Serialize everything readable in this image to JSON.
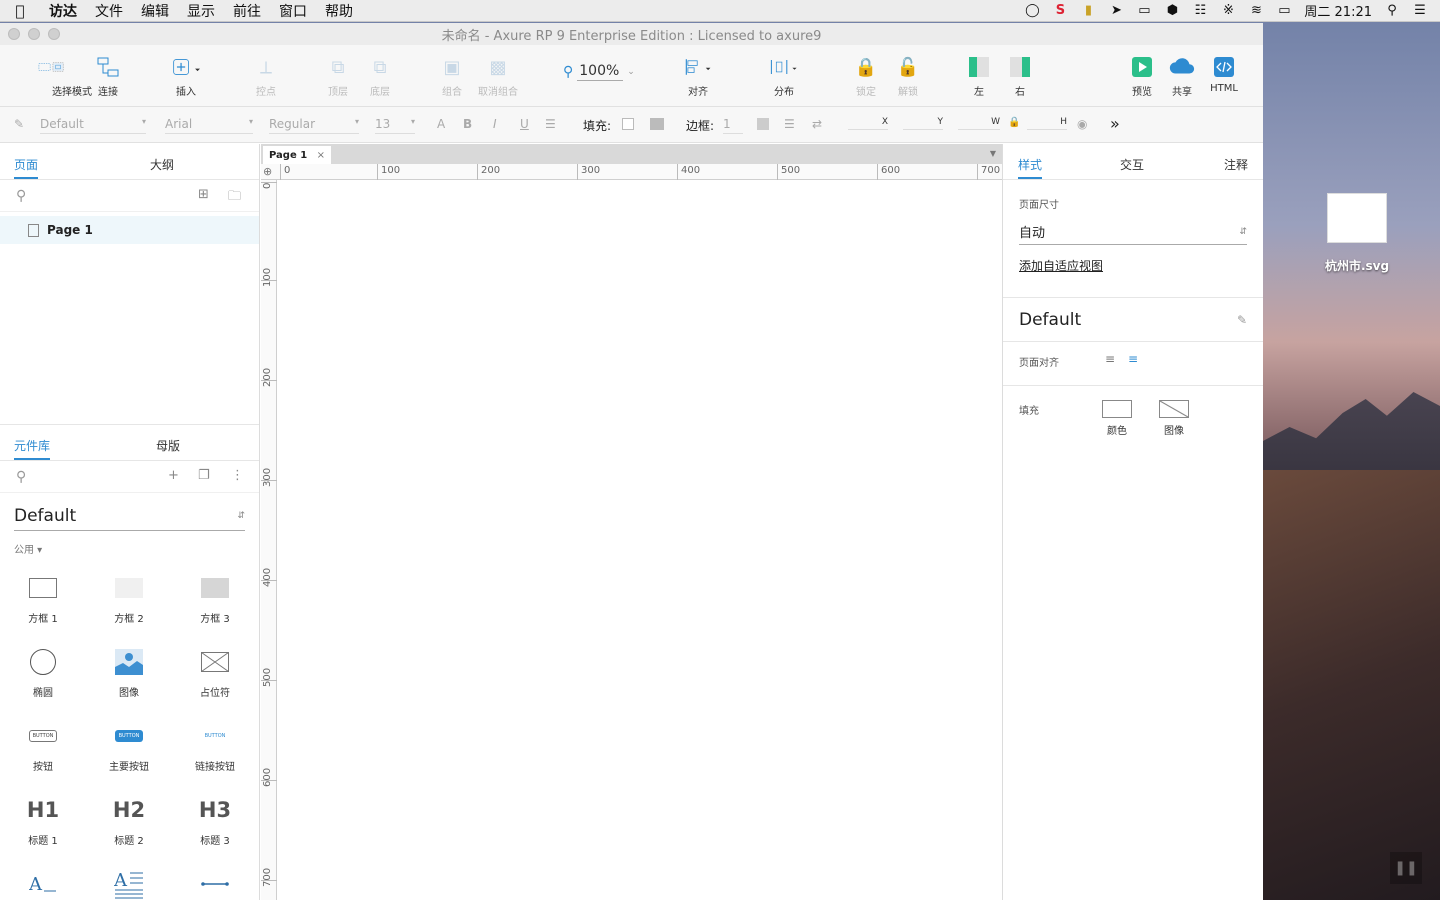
{
  "menubar": {
    "apple_icon": "apple-icon",
    "items": [
      "访达",
      "文件",
      "编辑",
      "显示",
      "前往",
      "窗口",
      "帮助"
    ],
    "clock": "周二 21:21"
  },
  "window": {
    "title": "未命名 - Axure RP 9 Enterprise Edition : Licensed to axure9"
  },
  "toolbar": {
    "select_mode": "选择模式",
    "connect": "连接",
    "insert": "插入",
    "points": "控点",
    "top": "顶层",
    "bottom": "底层",
    "group": "组合",
    "ungroup": "取消组合",
    "zoom": "100%",
    "align": "对齐",
    "distribute": "分布",
    "lock": "锁定",
    "unlock": "解锁",
    "left": "左",
    "right": "右",
    "preview": "预览",
    "share": "共享",
    "html": "HTML"
  },
  "formatbar": {
    "style": "Default",
    "font": "Arial",
    "weight": "Regular",
    "size": "13",
    "fill_label": "填充:",
    "border_label": "边框:",
    "border_width": "1",
    "x": "X",
    "y": "Y",
    "w": "W",
    "h": "H"
  },
  "leftpanel": {
    "tab_pages": "页面",
    "tab_outline": "大纲",
    "page_item": "Page 1",
    "tab_library": "元件库",
    "tab_masters": "母版",
    "library_name": "Default",
    "category": "公用 ▾",
    "widgets": [
      {
        "label": "方框 1",
        "icon": "box1-icon"
      },
      {
        "label": "方框 2",
        "icon": "box2-icon"
      },
      {
        "label": "方框 3",
        "icon": "box3-icon"
      },
      {
        "label": "椭圆",
        "icon": "ellipse-icon"
      },
      {
        "label": "图像",
        "icon": "image-icon"
      },
      {
        "label": "占位符",
        "icon": "placeholder-icon"
      },
      {
        "label": "按钮",
        "icon": "button-icon"
      },
      {
        "label": "主要按钮",
        "icon": "primary-button-icon"
      },
      {
        "label": "链接按钮",
        "icon": "link-button-icon"
      },
      {
        "label": "标题 1",
        "icon": "h1-icon"
      },
      {
        "label": "标题 2",
        "icon": "h2-icon"
      },
      {
        "label": "标题 3",
        "icon": "h3-icon"
      },
      {
        "label": "",
        "icon": "text-label-icon"
      },
      {
        "label": "",
        "icon": "paragraph-icon"
      },
      {
        "label": "",
        "icon": "line-icon"
      }
    ],
    "widget_text": {
      "button": "BUTTON",
      "h1": "H1",
      "h2": "H2",
      "h3": "H3"
    }
  },
  "canvas": {
    "tab_title": "Page 1",
    "ruler_h": [
      "0",
      "100",
      "200",
      "300",
      "400",
      "500",
      "600",
      "700"
    ],
    "ruler_v": [
      "0",
      "100",
      "200",
      "300",
      "400",
      "500",
      "600",
      "700"
    ]
  },
  "rightpanel": {
    "tab_style": "样式",
    "tab_interaction": "交互",
    "tab_notes": "注释",
    "page_size_label": "页面尺寸",
    "page_size_value": "自动",
    "add_adaptive": "添加自适应视图",
    "style_name": "Default",
    "page_align_label": "页面对齐",
    "fill_label": "填充",
    "fill_color": "颜色",
    "fill_image": "图像"
  },
  "desktop": {
    "file_name": "杭州市.svg"
  },
  "colors": {
    "accent": "#2e8bd1",
    "preview_green": "#2bbf8a",
    "panel_highlight": "#eef7fb"
  }
}
